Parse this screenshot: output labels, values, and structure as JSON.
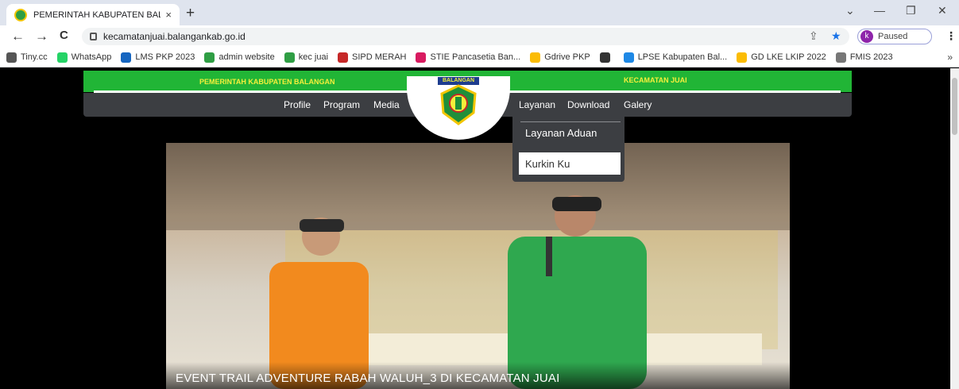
{
  "browser": {
    "tab_title": "PEMERINTAH KABUPATEN BALAN",
    "tab_close": "×",
    "new_tab": "+",
    "url": "kecamatanjuai.balangankab.go.id",
    "profile_initial": "k",
    "profile_status": "Paused",
    "window_controls": {
      "collapse": "⌄",
      "minimize": "—",
      "restore": "❐",
      "close": "✕"
    },
    "nav": {
      "back": "←",
      "forward": "→",
      "reload": "C"
    },
    "bookmarks": [
      {
        "label": "Tiny.cc",
        "color": "#555555"
      },
      {
        "label": "WhatsApp",
        "color": "#25d366"
      },
      {
        "label": "LMS PKP 2023",
        "color": "#1565c0"
      },
      {
        "label": "admin website",
        "color": "#2f9e44"
      },
      {
        "label": "kec juai",
        "color": "#2f9e44"
      },
      {
        "label": "SIPD MERAH",
        "color": "#c62828"
      },
      {
        "label": "STIE Pancasetia Ban...",
        "color": "#d81b60"
      },
      {
        "label": "Gdrive PKP",
        "color": "#fbbc04"
      },
      {
        "label": "",
        "color": "#333333"
      },
      {
        "label": "LPSE Kabupaten Bal...",
        "color": "#1e88e5"
      },
      {
        "label": "GD LKE LKIP 2022",
        "color": "#fbbc04"
      },
      {
        "label": "FMIS 2023",
        "color": "#777777"
      }
    ],
    "bookmarks_more": "»"
  },
  "site": {
    "header_left": "PEMERINTAH KABUPATEN BALANGAN",
    "header_right": "KECAMATAN JUAI",
    "logo_text": "BALANGAN",
    "nav_left": [
      "Profile",
      "Program",
      "Media"
    ],
    "nav_right": [
      "Layanan",
      "Download",
      "Galery"
    ],
    "dropdown": [
      "Layanan Aduan",
      "Kurkin Ku"
    ],
    "hero_caption": "EVENT TRAIL ADVENTURE RABAH WALUH_3 DI KECAMATAN JUAI"
  },
  "colors": {
    "header_green": "#21b536",
    "header_text": "#f5ef3b",
    "nav_dark": "#3c3e42"
  }
}
